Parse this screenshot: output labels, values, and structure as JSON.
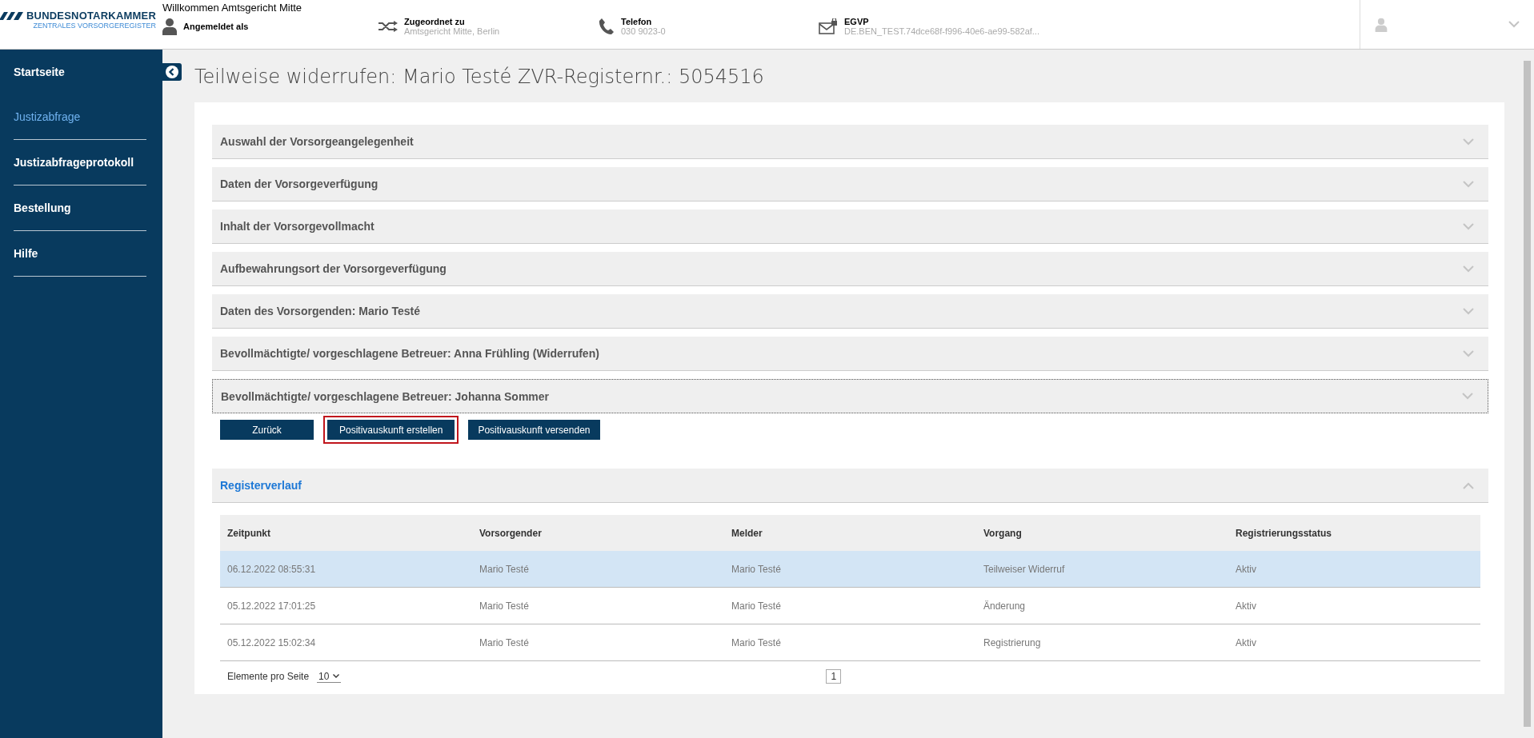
{
  "header": {
    "logo": {
      "title": "BUNDESNOTARKAMMER",
      "subtitle": "ZENTRALES VORSORGEREGISTER"
    },
    "welcome": "Willkommen Amtsgericht Mitte",
    "info": [
      {
        "kind": "user",
        "label": "Angemeldet als"
      },
      {
        "kind": "assigned",
        "label": "Zugeordnet zu",
        "value": "Amtsgericht Mitte, Berlin"
      },
      {
        "kind": "phone",
        "label": "Telefon",
        "value": "030 9023-0"
      },
      {
        "kind": "mail",
        "label": "EGVP",
        "value": "DE.BEN_TEST.74dce68f-f996-40e6-ae99-582af..."
      }
    ]
  },
  "sidebar": {
    "items": [
      {
        "label": "Startseite",
        "selected": false
      },
      {
        "label": "Justizabfrage",
        "selected": true
      },
      {
        "label": "Justizabfrageprotokoll",
        "selected": false
      },
      {
        "label": "Bestellung",
        "selected": false
      },
      {
        "label": "Hilfe",
        "selected": false
      }
    ]
  },
  "page_title": "Teilweise widerrufen: Mario Testé ZVR-Registernr.: 5054516",
  "sections": [
    {
      "label": "Auswahl der Vorsorgeangelegenheit",
      "expanded": false,
      "focused": false
    },
    {
      "label": "Daten der Vorsorgeverfügung",
      "expanded": false,
      "focused": false
    },
    {
      "label": "Inhalt der Vorsorgevollmacht",
      "expanded": false,
      "focused": false
    },
    {
      "label": "Aufbewahrungsort der Vorsorgeverfügung",
      "expanded": false,
      "focused": false
    },
    {
      "label": "Daten des Vorsorgenden: Mario Testé",
      "expanded": false,
      "focused": false
    },
    {
      "label": "Bevollmächtigte/ vorgeschlagene Betreuer: Anna Frühling (Widerrufen)",
      "expanded": false,
      "focused": false
    },
    {
      "label": "Bevollmächtigte/ vorgeschlagene Betreuer: Johanna Sommer",
      "expanded": false,
      "focused": true
    }
  ],
  "buttons": [
    {
      "label": "Zurück",
      "focused": false
    },
    {
      "label": "Positivauskunft erstellen",
      "focused": true
    },
    {
      "label": "Positivauskunft versenden",
      "focused": false
    }
  ],
  "history": {
    "title": "Registerverlauf",
    "expanded": true,
    "columns": [
      "Zeitpunkt",
      "Vorsorgender",
      "Melder",
      "Vorgang",
      "Registrierungsstatus"
    ],
    "rows": [
      {
        "cells": [
          "06.12.2022 08:55:31",
          "Mario Testé",
          "Mario Testé",
          "Teilweiser Widerruf",
          "Aktiv"
        ],
        "selected": true
      },
      {
        "cells": [
          "05.12.2022 17:01:25",
          "Mario Testé",
          "Mario Testé",
          "Änderung",
          "Aktiv"
        ],
        "selected": false
      },
      {
        "cells": [
          "05.12.2022 15:02:34",
          "Mario Testé",
          "Mario Testé",
          "Registrierung",
          "Aktiv"
        ],
        "selected": false
      }
    ],
    "page_size_label": "Elemente pro Seite",
    "page_size": "10",
    "pages": [
      {
        "label": "1",
        "selected": true
      }
    ]
  }
}
